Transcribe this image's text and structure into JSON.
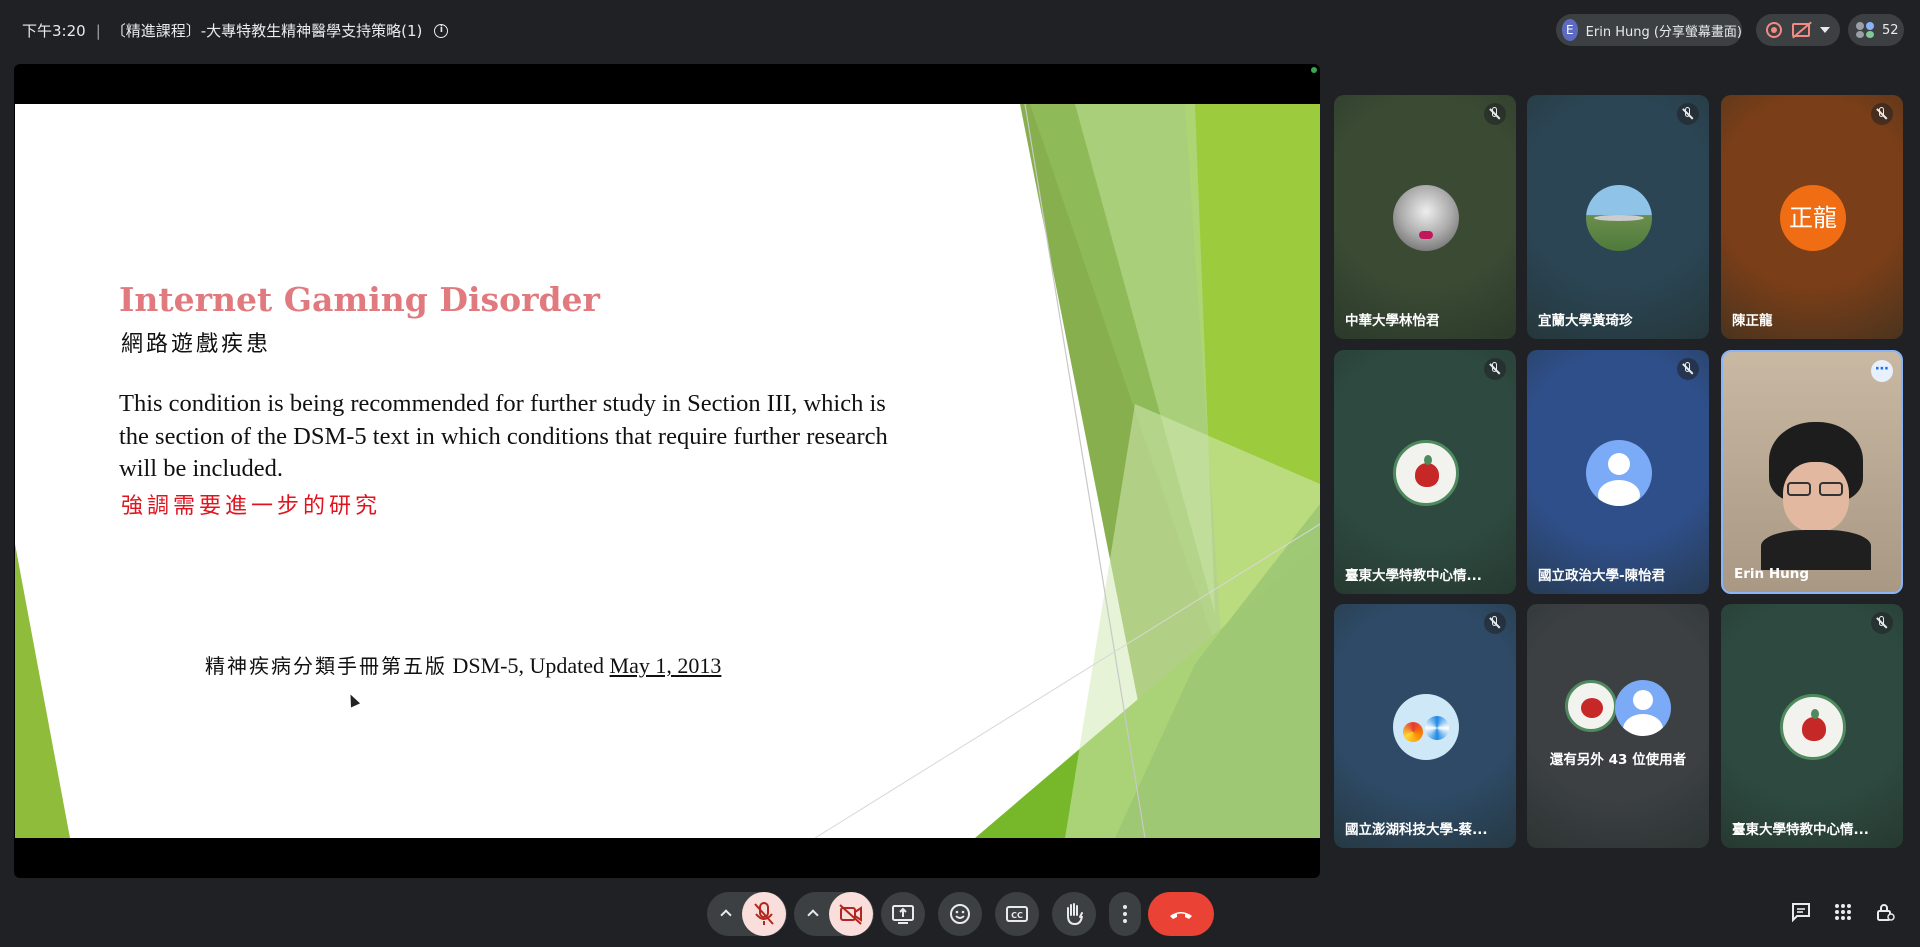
{
  "meeting": {
    "time": "下午3:20",
    "separator": "|",
    "title": "〔精進課程〕-大專特教生精神醫學支持策略(1)"
  },
  "presenter": {
    "avatar_letter": "E",
    "label": "Erin Hung (分享螢幕畫面)"
  },
  "participants_count": "52",
  "slide": {
    "title": "Internet Gaming Disorder",
    "subtitle": "網路遊戲疾患",
    "body": "This condition is being recommended for further study in Section III, which is the section of the DSM-5 text in which conditions that require further research will be included.",
    "emphasis": "強調需要進一步的研究",
    "footer_zh": "精神疾病分類手冊第五版",
    "footer_en": "DSM-5, Updated",
    "footer_date": "May 1, 2013"
  },
  "tiles": [
    {
      "name": "中華大學林怡君",
      "bg": "#3a4a33",
      "mic_off": true,
      "avatar": "photo-flowers"
    },
    {
      "name": "宜蘭大學黃琦珍",
      "bg": "#2b4554",
      "mic_off": true,
      "avatar": "photo-landscape"
    },
    {
      "name": "陳正龍",
      "bg": "#7a3e18",
      "mic_off": true,
      "avatar_text": "正龍",
      "avatar_color": "#f06d14"
    },
    {
      "name": "臺東大學特教中心情...",
      "bg": "#2e4a40",
      "mic_off": true,
      "avatar": "apple-logo"
    },
    {
      "name": "國立政治大學-陳怡君",
      "bg": "#2f4f8a",
      "mic_off": true,
      "avatar": "default-person"
    },
    {
      "name": "Erin Hung",
      "bg": "#b8a894",
      "mic_off": false,
      "avatar": "video-feed"
    },
    {
      "name": "國立澎湖科技大學-蔡...",
      "bg": "#2e4a66",
      "mic_off": true,
      "avatar": "pinwheel-logo"
    },
    {
      "name": "還有另外 43 位使用者",
      "bg": "#3c4043",
      "mic_off": false,
      "avatar": "group"
    },
    {
      "name": "臺東大學特教中心情...",
      "bg": "#2e4a40",
      "mic_off": true,
      "avatar": "apple-logo"
    }
  ],
  "controls": {
    "mic": "mic-off-icon",
    "camera": "camera-off-icon",
    "present": "present-icon",
    "emoji": "emoji-icon",
    "captions": "CC",
    "hand": "raise-hand-icon",
    "more": "more-icon",
    "end": "end-call-icon"
  },
  "colors": {
    "end_call": "#ea4335",
    "muted_bg": "#f9dedc",
    "slide_title": "#e07a7f",
    "slide_emphasis": "#e0141e"
  }
}
